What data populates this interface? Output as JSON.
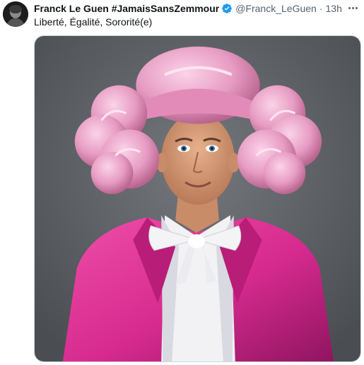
{
  "tweet": {
    "author_name": "Franck Le Guen #JamaisSansZemmour",
    "handle": "@Franck_LeGuen",
    "separator": "·",
    "time": "13h",
    "text": "Liberté, Égalité, Sororité(e)",
    "verified": true
  },
  "icons": {
    "verified": "verified-badge-icon",
    "more": "more-options-icon"
  },
  "colors": {
    "verified_blue": "#1d9bf0",
    "secondary_text": "#536471",
    "suit_pink": "#d62a8f",
    "wig_pink": "#e79cc3",
    "background_gray": "#5e6166"
  }
}
